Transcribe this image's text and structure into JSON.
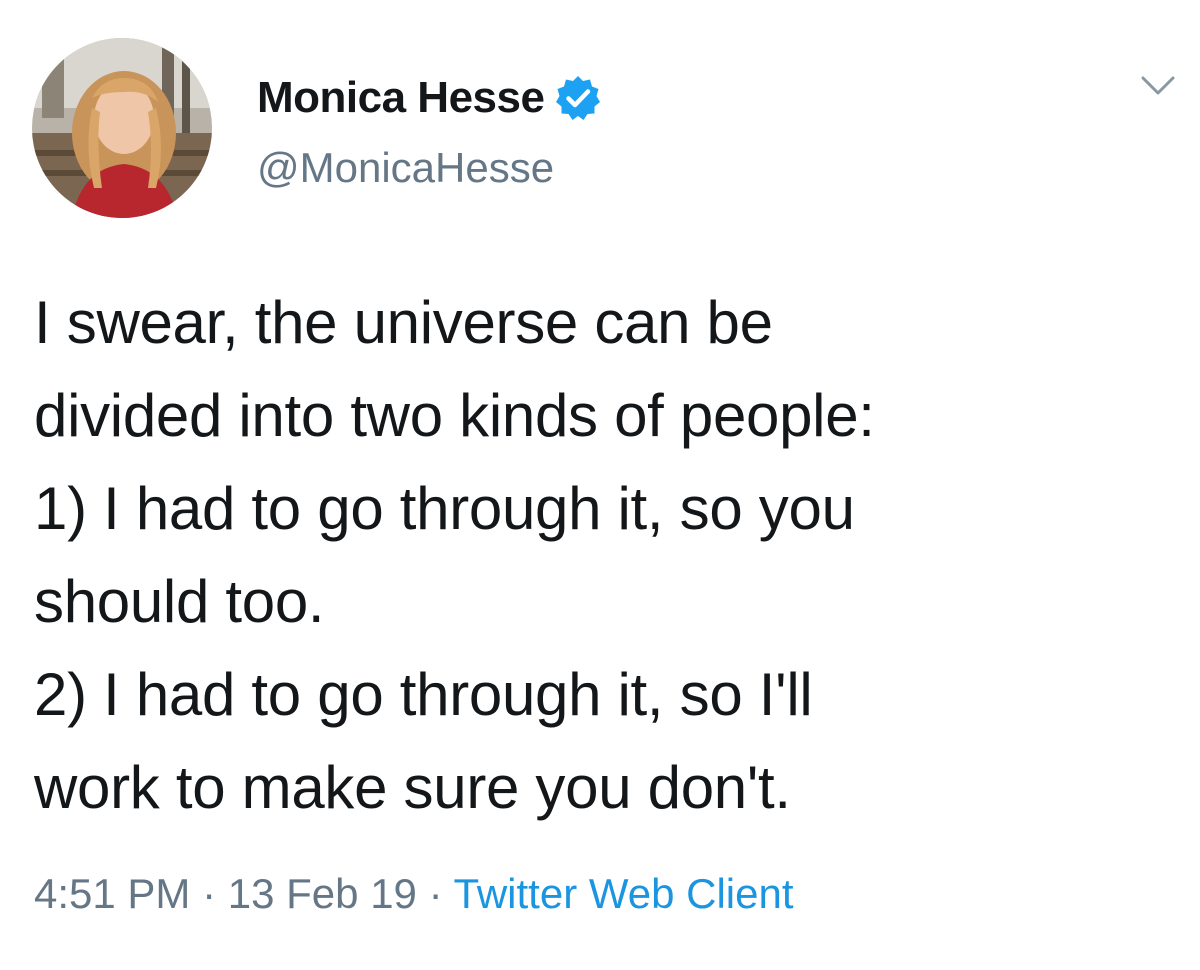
{
  "author": {
    "display_name": "Monica Hesse",
    "handle": "@MonicaHesse",
    "verified": true,
    "verified_icon": "verified-badge-icon"
  },
  "menu_icon": "chevron-down-icon",
  "tweet": {
    "lines": [
      "I swear, the universe can be",
      "divided into two kinds of people:",
      "1) I had to go through it, so you",
      "should too.",
      "2) I had to go through it, so I'll",
      "work to make sure you don't."
    ]
  },
  "meta": {
    "time": "4:51 PM",
    "separator": "·",
    "date": "13 Feb 19",
    "source": "Twitter Web Client"
  },
  "colors": {
    "text": "#14171a",
    "secondary": "#657786",
    "link": "#1b95e0",
    "verified": "#1da1f2"
  }
}
